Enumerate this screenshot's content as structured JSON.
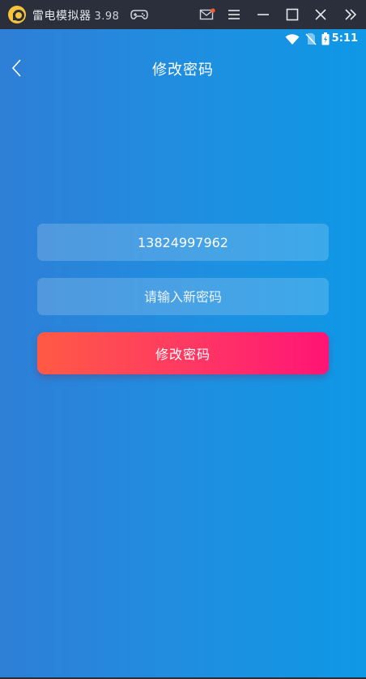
{
  "emulator": {
    "app_name": "雷电模拟器",
    "version": "3.98",
    "icons": [
      "gamepad-icon",
      "mail-icon",
      "menu-icon",
      "minimize-icon",
      "maximize-icon",
      "close-icon",
      "collapse-icon"
    ]
  },
  "statusbar": {
    "time": "5:11",
    "icons": [
      "wifi-icon",
      "no-sim-icon",
      "battery-icon"
    ]
  },
  "page": {
    "title": "修改密码"
  },
  "form": {
    "phone_value": "13824997962",
    "password_placeholder": "请输入新密码",
    "submit_label": "修改密码"
  },
  "colors": {
    "titlebar": "#2b2f3b",
    "bg_gradient_start": "#2e7fd6",
    "bg_gradient_end": "#0e98e6",
    "button_gradient_start": "#ff5a45",
    "button_gradient_end": "#ff1475",
    "mail_dot": "#ff5a2a"
  }
}
